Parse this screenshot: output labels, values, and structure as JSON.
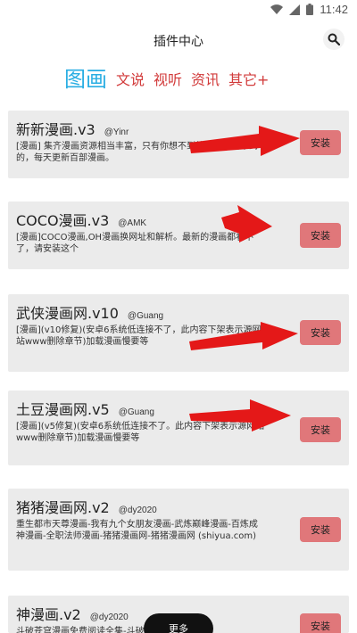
{
  "status_bar": {
    "time": "11:42",
    "icons": [
      "wifi-icon",
      "signal-icon",
      "battery-icon"
    ]
  },
  "header": {
    "title": "插件中心",
    "search_icon": "search-icon"
  },
  "tabs": [
    {
      "label": "图画",
      "active": true
    },
    {
      "label": "文说",
      "active": false
    },
    {
      "label": "视听",
      "active": false
    },
    {
      "label": "资讯",
      "active": false
    },
    {
      "label": "其它+",
      "active": false
    }
  ],
  "plugins": [
    {
      "name": "新新漫画.v3",
      "author": "@Yinr",
      "desc": "[漫画] 集齐漫画资源相当丰富，只有你想不到的，没有看不到的，每天更新百部漫画。",
      "button": "安装"
    },
    {
      "name": "COCO漫画.v3",
      "author": "@AMK",
      "desc": "[漫画]COCO漫画,OH漫画换网址和解析。最新的漫画都看不了，请安装这个",
      "button": "安装"
    },
    {
      "name": "武侠漫画网.v10",
      "author": "@Guang",
      "desc": "[漫画](v10修复)(安卓6系统低连接不了，此内容下架表示源网站www删除章节)加载漫画慢要等",
      "button": "安装"
    },
    {
      "name": "土豆漫画网.v5",
      "author": "@Guang",
      "desc": "[漫画](v5修复)(安卓6系统低连接不了。此内容下架表示源网站www删除章节)加载漫画慢要等",
      "button": "安装"
    },
    {
      "name": "猪猪漫画网.v2",
      "author": "@dy2020",
      "desc": "重生都市天尊漫画-我有九个女朋友漫画-武炼巅峰漫画-百炼成神漫画-全职法师漫画-猪猪漫画网-猪猪漫画网 (shiyua.com)",
      "button": "安装"
    },
    {
      "name": "神漫画.v2",
      "author": "@dy2020",
      "desc": "斗破苍穹漫画免费阅读全集-斗破苍穹漫画",
      "button": "安装"
    }
  ],
  "more_button": "更多"
}
